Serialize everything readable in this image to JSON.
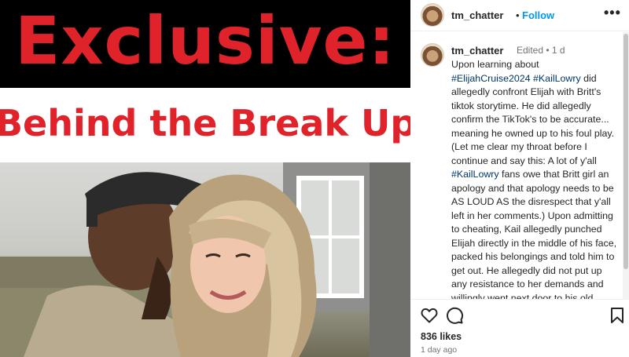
{
  "image": {
    "headline_line1": "Exclusive:",
    "headline_line2": "Behind the Break Up",
    "headline_color": "#e0232b"
  },
  "post": {
    "username": "tm_chatter",
    "separator": "•",
    "follow_label": "Follow",
    "more_icon": "more-options-icon"
  },
  "caption": {
    "username": "tm_chatter",
    "meta": "Edited • 1 d",
    "text_parts": [
      "Upon learning about ",
      "#ElijahCruise2024",
      " ",
      "#KailLowry",
      " did allegedly confront Elijah with Britt's tiktok storytime. He did allegedly confirm the TikTok's to be accurate... meaning he owned up to his foul play. (Let me clear my throat before I continue and say this: A lot of y'all ",
      "#KailLowry",
      " fans owe that Britt girl an apology and that apology needs to be AS LOUD AS the disrespect that y'all left in her comments.) Upon admitting to cheating, Kail allegedly punched Elijah directly in the middle of his face, packed his belongings and told him to get out. He allegedly did not put up any resistance to her demands and willingly went next door to his old home that had recently became vacant after a tenant had moved out weeks prior. Kail allegedly told him to take"
    ]
  },
  "actions": {
    "like_icon": "heart-icon",
    "comment_icon": "comment-icon",
    "save_icon": "bookmark-icon",
    "likes": "836 likes",
    "time": "1 day ago"
  }
}
